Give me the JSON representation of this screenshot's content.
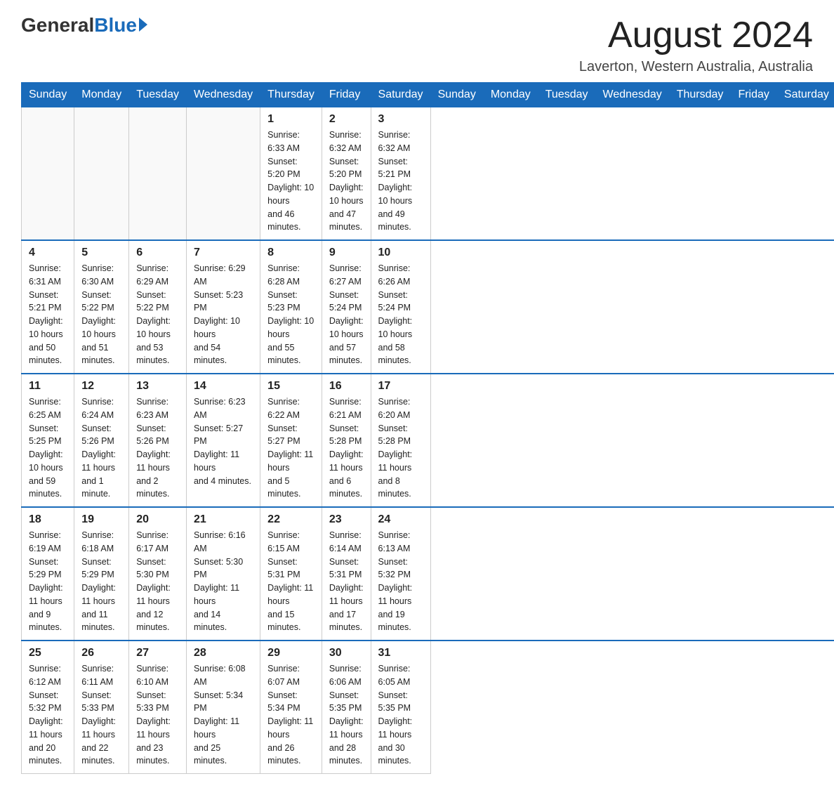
{
  "header": {
    "logo_general": "General",
    "logo_blue": "Blue",
    "month_title": "August 2024",
    "location": "Laverton, Western Australia, Australia"
  },
  "days_of_week": [
    "Sunday",
    "Monday",
    "Tuesday",
    "Wednesday",
    "Thursday",
    "Friday",
    "Saturday"
  ],
  "weeks": [
    [
      {
        "day": "",
        "info": ""
      },
      {
        "day": "",
        "info": ""
      },
      {
        "day": "",
        "info": ""
      },
      {
        "day": "",
        "info": ""
      },
      {
        "day": "1",
        "info": "Sunrise: 6:33 AM\nSunset: 5:20 PM\nDaylight: 10 hours\nand 46 minutes."
      },
      {
        "day": "2",
        "info": "Sunrise: 6:32 AM\nSunset: 5:20 PM\nDaylight: 10 hours\nand 47 minutes."
      },
      {
        "day": "3",
        "info": "Sunrise: 6:32 AM\nSunset: 5:21 PM\nDaylight: 10 hours\nand 49 minutes."
      }
    ],
    [
      {
        "day": "4",
        "info": "Sunrise: 6:31 AM\nSunset: 5:21 PM\nDaylight: 10 hours\nand 50 minutes."
      },
      {
        "day": "5",
        "info": "Sunrise: 6:30 AM\nSunset: 5:22 PM\nDaylight: 10 hours\nand 51 minutes."
      },
      {
        "day": "6",
        "info": "Sunrise: 6:29 AM\nSunset: 5:22 PM\nDaylight: 10 hours\nand 53 minutes."
      },
      {
        "day": "7",
        "info": "Sunrise: 6:29 AM\nSunset: 5:23 PM\nDaylight: 10 hours\nand 54 minutes."
      },
      {
        "day": "8",
        "info": "Sunrise: 6:28 AM\nSunset: 5:23 PM\nDaylight: 10 hours\nand 55 minutes."
      },
      {
        "day": "9",
        "info": "Sunrise: 6:27 AM\nSunset: 5:24 PM\nDaylight: 10 hours\nand 57 minutes."
      },
      {
        "day": "10",
        "info": "Sunrise: 6:26 AM\nSunset: 5:24 PM\nDaylight: 10 hours\nand 58 minutes."
      }
    ],
    [
      {
        "day": "11",
        "info": "Sunrise: 6:25 AM\nSunset: 5:25 PM\nDaylight: 10 hours\nand 59 minutes."
      },
      {
        "day": "12",
        "info": "Sunrise: 6:24 AM\nSunset: 5:26 PM\nDaylight: 11 hours\nand 1 minute."
      },
      {
        "day": "13",
        "info": "Sunrise: 6:23 AM\nSunset: 5:26 PM\nDaylight: 11 hours\nand 2 minutes."
      },
      {
        "day": "14",
        "info": "Sunrise: 6:23 AM\nSunset: 5:27 PM\nDaylight: 11 hours\nand 4 minutes."
      },
      {
        "day": "15",
        "info": "Sunrise: 6:22 AM\nSunset: 5:27 PM\nDaylight: 11 hours\nand 5 minutes."
      },
      {
        "day": "16",
        "info": "Sunrise: 6:21 AM\nSunset: 5:28 PM\nDaylight: 11 hours\nand 6 minutes."
      },
      {
        "day": "17",
        "info": "Sunrise: 6:20 AM\nSunset: 5:28 PM\nDaylight: 11 hours\nand 8 minutes."
      }
    ],
    [
      {
        "day": "18",
        "info": "Sunrise: 6:19 AM\nSunset: 5:29 PM\nDaylight: 11 hours\nand 9 minutes."
      },
      {
        "day": "19",
        "info": "Sunrise: 6:18 AM\nSunset: 5:29 PM\nDaylight: 11 hours\nand 11 minutes."
      },
      {
        "day": "20",
        "info": "Sunrise: 6:17 AM\nSunset: 5:30 PM\nDaylight: 11 hours\nand 12 minutes."
      },
      {
        "day": "21",
        "info": "Sunrise: 6:16 AM\nSunset: 5:30 PM\nDaylight: 11 hours\nand 14 minutes."
      },
      {
        "day": "22",
        "info": "Sunrise: 6:15 AM\nSunset: 5:31 PM\nDaylight: 11 hours\nand 15 minutes."
      },
      {
        "day": "23",
        "info": "Sunrise: 6:14 AM\nSunset: 5:31 PM\nDaylight: 11 hours\nand 17 minutes."
      },
      {
        "day": "24",
        "info": "Sunrise: 6:13 AM\nSunset: 5:32 PM\nDaylight: 11 hours\nand 19 minutes."
      }
    ],
    [
      {
        "day": "25",
        "info": "Sunrise: 6:12 AM\nSunset: 5:32 PM\nDaylight: 11 hours\nand 20 minutes."
      },
      {
        "day": "26",
        "info": "Sunrise: 6:11 AM\nSunset: 5:33 PM\nDaylight: 11 hours\nand 22 minutes."
      },
      {
        "day": "27",
        "info": "Sunrise: 6:10 AM\nSunset: 5:33 PM\nDaylight: 11 hours\nand 23 minutes."
      },
      {
        "day": "28",
        "info": "Sunrise: 6:08 AM\nSunset: 5:34 PM\nDaylight: 11 hours\nand 25 minutes."
      },
      {
        "day": "29",
        "info": "Sunrise: 6:07 AM\nSunset: 5:34 PM\nDaylight: 11 hours\nand 26 minutes."
      },
      {
        "day": "30",
        "info": "Sunrise: 6:06 AM\nSunset: 5:35 PM\nDaylight: 11 hours\nand 28 minutes."
      },
      {
        "day": "31",
        "info": "Sunrise: 6:05 AM\nSunset: 5:35 PM\nDaylight: 11 hours\nand 30 minutes."
      }
    ]
  ]
}
